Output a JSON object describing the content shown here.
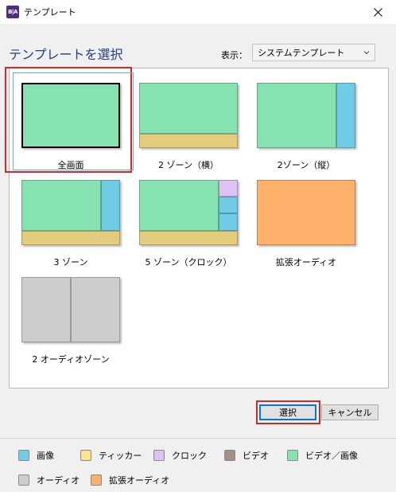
{
  "window": {
    "title": "テンプレート",
    "app_icon_text": "B|A"
  },
  "header": {
    "heading": "テンプレートを選択",
    "display_label": "表示：",
    "display_value": "システムテンプレート"
  },
  "templates": [
    {
      "label": "全画面"
    },
    {
      "label": "2 ゾーン（横）"
    },
    {
      "label": "2ゾーン（縦）"
    },
    {
      "label": "3 ゾーン"
    },
    {
      "label": "5 ゾーン（クロック）"
    },
    {
      "label": "拡張オーディオ"
    },
    {
      "label": "2 オーディオゾーン"
    }
  ],
  "selected_template": "全画面",
  "buttons": {
    "select": "選択",
    "cancel": "キャンセル"
  },
  "legend": [
    {
      "label": "画像",
      "color": "#70cbe4"
    },
    {
      "label": "ティッカー",
      "color": "#f9e58c"
    },
    {
      "label": "クロック",
      "color": "#dcc3f3"
    },
    {
      "label": "ビデオ",
      "color": "#a58f85"
    },
    {
      "label": "ビデオ／画像",
      "color": "#86e2b0"
    },
    {
      "label": "オーディオ",
      "color": "#cdcdcd"
    },
    {
      "label": "拡張オーディオ",
      "color": "#fdb16b"
    }
  ]
}
